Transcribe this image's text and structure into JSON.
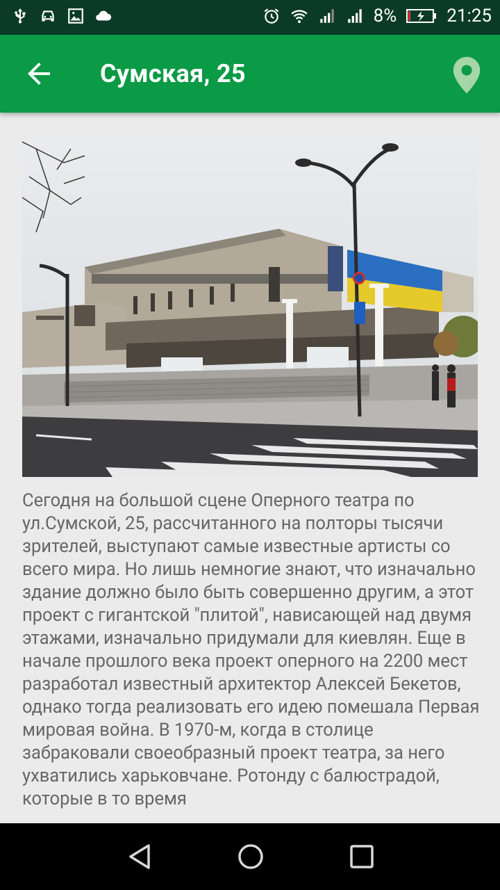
{
  "status_bar": {
    "battery_percent": "8%",
    "time": "21:25",
    "left_icons": [
      "usb-icon",
      "car-icon",
      "image-icon",
      "cloud-icon"
    ],
    "right_icons": [
      "alarm-icon",
      "wifi-icon",
      "signal-icon",
      "signal-icon",
      "battery-charging-icon"
    ]
  },
  "app_bar": {
    "title": "Сумская, 25",
    "back_icon": "arrow-left-icon",
    "map_icon": "map-pin-icon",
    "color": "#0b9a45"
  },
  "article": {
    "image_alt": "Харьковский театр оперы и балета",
    "text": "Сегодня на большой сцене Оперного театра по ул.Сумской, 25, рассчитанного на полторы тысячи зрителей, выступают самые известные артисты со всего мира. Но лишь немногие знают, что изначально здание должно было быть совершенно другим, а этот проект с гигантской \"плитой\", нависающей над двумя этажами, изначально придумали для киевлян. Еще в начале прошлого века проект оперного на 2200 мест разработал известный архитектор Алексей Бекетов, однако тогда реализовать его идею помешала Первая мировая война. В 1970-м, когда в столице забраковали своеобразный проект театра, за него ухватились харьковчане. Ротонду с балюстрадой, которые в то время"
  },
  "nav_bar": {
    "icons": [
      "back-triangle-icon",
      "home-circle-icon",
      "recents-square-icon"
    ]
  }
}
